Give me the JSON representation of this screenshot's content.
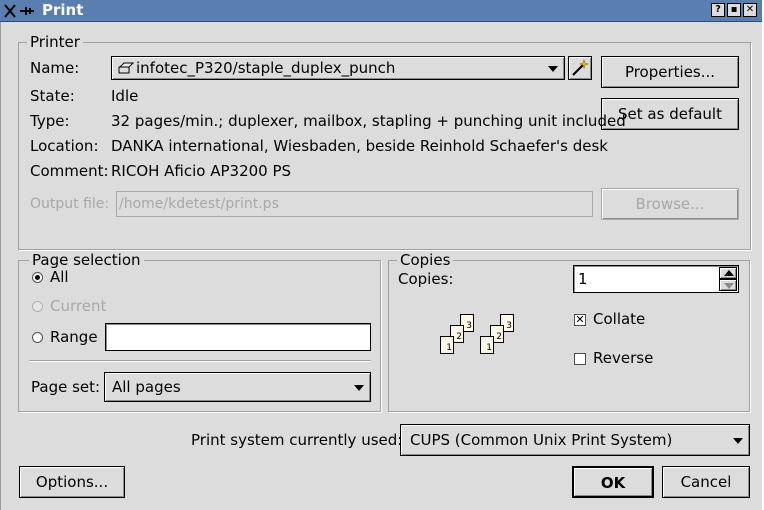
{
  "window": {
    "title": "Print"
  },
  "printer_group": {
    "title": "Printer",
    "name_label": "Name:",
    "name_value": "infotec_P320/staple_duplex_punch",
    "state_label": "State:",
    "state_value": "Idle",
    "type_label": "Type:",
    "type_value": "32 pages/min.; duplexer, mailbox, stapling + punching unit included",
    "location_label": "Location:",
    "location_value": "DANKA international, Wiesbaden, beside Reinhold Schaefer's desk",
    "comment_label": "Comment:",
    "comment_value": "RICOH Aficio AP3200 PS",
    "output_file_label": "Output file:",
    "output_file_value": "/home/kdetest/print.ps",
    "properties_button": "Properties...",
    "set_default_button": "Set as default",
    "browse_button": "Browse..."
  },
  "page_selection": {
    "title": "Page selection",
    "all_label": "All",
    "current_label": "Current",
    "range_label": "Range",
    "range_value": "",
    "page_set_label": "Page set:",
    "page_set_value": "All pages",
    "selected": "All"
  },
  "copies": {
    "title": "Copies",
    "copies_label": "Copies:",
    "copies_value": "1",
    "collate_label": "Collate",
    "collate_checked": true,
    "reverse_label": "Reverse",
    "reverse_checked": false,
    "page_numbers": [
      "1",
      "2",
      "3"
    ]
  },
  "footer": {
    "print_system_label": "Print system currently used:",
    "print_system_value": "CUPS (Common Unix Print System)",
    "options_button": "Options...",
    "ok_button": "OK",
    "cancel_button": "Cancel"
  }
}
